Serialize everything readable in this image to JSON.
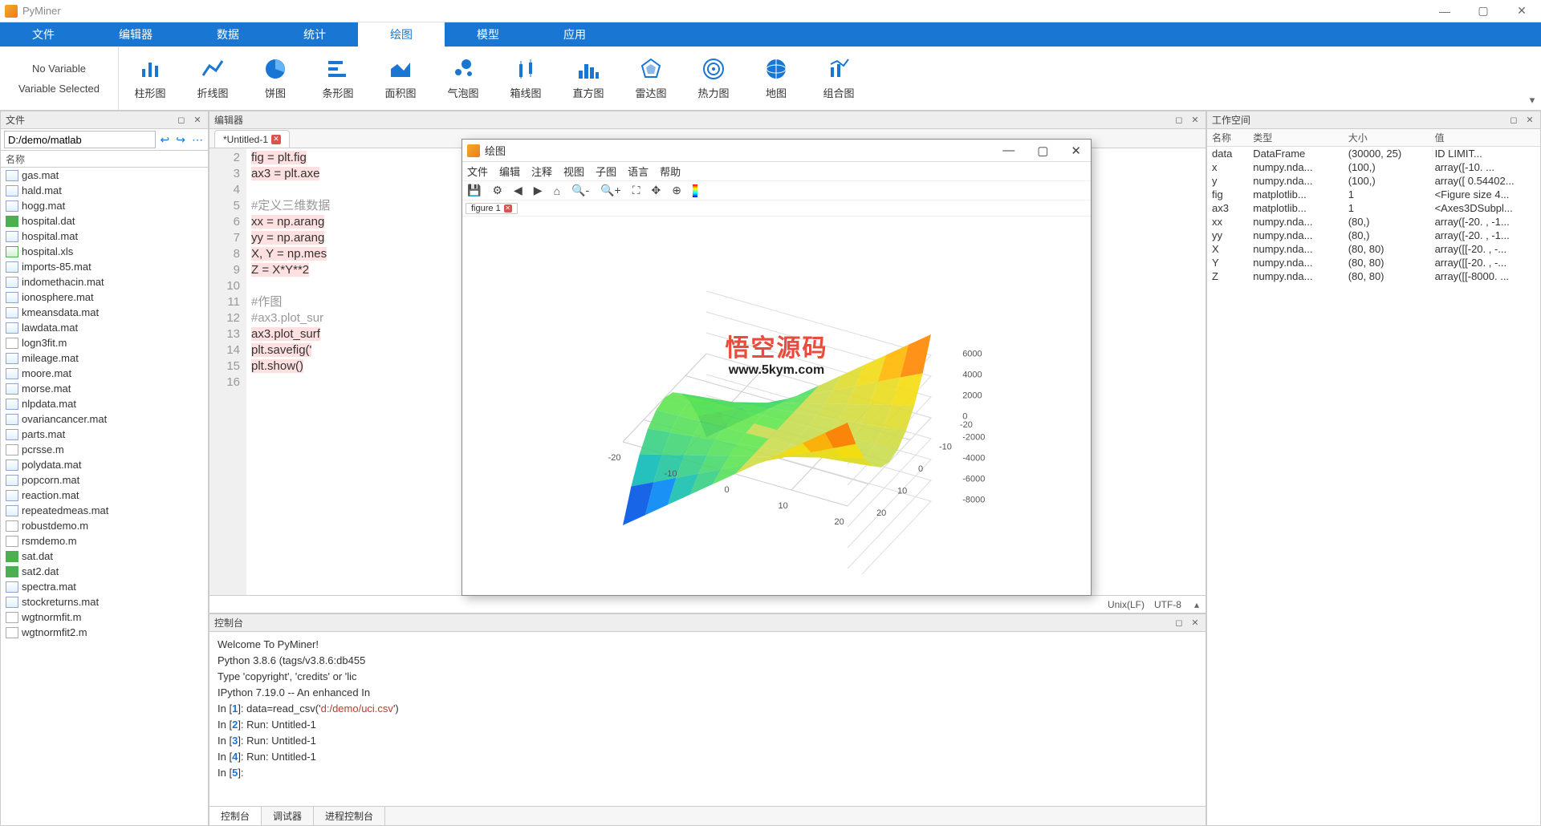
{
  "app": {
    "title": "PyMiner"
  },
  "mainmenu": [
    "文件",
    "编辑器",
    "数据",
    "统计",
    "绘图",
    "模型",
    "应用"
  ],
  "mainmenu_active": 4,
  "ribbon": {
    "var_top": "No Variable",
    "var_bottom": "Variable Selected",
    "tools": [
      "柱形图",
      "折线图",
      "饼图",
      "条形图",
      "面积图",
      "气泡图",
      "箱线图",
      "直方图",
      "雷达图",
      "热力图",
      "地图",
      "组合图"
    ]
  },
  "filePanel": {
    "title": "文件",
    "path": "D:/demo/matlab",
    "colHeader": "名称",
    "files": [
      {
        "name": "gas.mat",
        "type": "mat"
      },
      {
        "name": "hald.mat",
        "type": "mat"
      },
      {
        "name": "hogg.mat",
        "type": "mat"
      },
      {
        "name": "hospital.dat",
        "type": "dat"
      },
      {
        "name": "hospital.mat",
        "type": "mat"
      },
      {
        "name": "hospital.xls",
        "type": "xls"
      },
      {
        "name": "imports-85.mat",
        "type": "mat"
      },
      {
        "name": "indomethacin.mat",
        "type": "mat"
      },
      {
        "name": "ionosphere.mat",
        "type": "mat"
      },
      {
        "name": "kmeansdata.mat",
        "type": "mat"
      },
      {
        "name": "lawdata.mat",
        "type": "mat"
      },
      {
        "name": "logn3fit.m",
        "type": "mfile"
      },
      {
        "name": "mileage.mat",
        "type": "mat"
      },
      {
        "name": "moore.mat",
        "type": "mat"
      },
      {
        "name": "morse.mat",
        "type": "mat"
      },
      {
        "name": "nlpdata.mat",
        "type": "mat"
      },
      {
        "name": "ovariancancer.mat",
        "type": "mat"
      },
      {
        "name": "parts.mat",
        "type": "mat"
      },
      {
        "name": "pcrsse.m",
        "type": "mfile"
      },
      {
        "name": "polydata.mat",
        "type": "mat"
      },
      {
        "name": "popcorn.mat",
        "type": "mat"
      },
      {
        "name": "reaction.mat",
        "type": "mat"
      },
      {
        "name": "repeatedmeas.mat",
        "type": "mat"
      },
      {
        "name": "robustdemo.m",
        "type": "mfile"
      },
      {
        "name": "rsmdemo.m",
        "type": "mfile"
      },
      {
        "name": "sat.dat",
        "type": "dat"
      },
      {
        "name": "sat2.dat",
        "type": "dat"
      },
      {
        "name": "spectra.mat",
        "type": "mat"
      },
      {
        "name": "stockreturns.mat",
        "type": "mat"
      },
      {
        "name": "wgtnormfit.m",
        "type": "mfile"
      },
      {
        "name": "wgtnormfit2.m",
        "type": "mfile"
      }
    ]
  },
  "editor": {
    "panelTitle": "编辑器",
    "tab": "*Untitled-1",
    "lineStart": 2,
    "lines": [
      {
        "t": "fig = plt.fig",
        "cls": "kw"
      },
      {
        "t": "ax3 = plt.axe",
        "cls": "kw"
      },
      {
        "t": "",
        "cls": ""
      },
      {
        "t": "#定义三维数据",
        "cls": "cmt"
      },
      {
        "t": "xx = np.arang",
        "cls": "kw"
      },
      {
        "t": "yy = np.arang",
        "cls": "kw"
      },
      {
        "t": "X, Y = np.mes",
        "cls": "kw"
      },
      {
        "t": "Z = X*Y**2",
        "cls": "kw"
      },
      {
        "t": "",
        "cls": ""
      },
      {
        "t": "#作图",
        "cls": "cmt"
      },
      {
        "t": "#ax3.plot_sur",
        "cls": "cmt"
      },
      {
        "t": "ax3.plot_surf",
        "cls": "kw"
      },
      {
        "t": "plt.savefig('",
        "cls": "kw"
      },
      {
        "t": "plt.show()",
        "cls": "kw"
      },
      {
        "t": "",
        "cls": ""
      }
    ],
    "status": {
      "eol": "Unix(LF)",
      "enc": "UTF-8"
    }
  },
  "console": {
    "panelTitle": "控制台",
    "welcome": [
      "Welcome To PyMiner!",
      "Python 3.8.6 (tags/v3.8.6:db455",
      "Type 'copyright', 'credits' or 'lic",
      "IPython 7.19.0 -- An enhanced In"
    ],
    "entries": [
      {
        "n": "1",
        "t": "data=read_csv('",
        "path": "d:/demo/uci.csv",
        "tail": "')"
      },
      {
        "n": "2",
        "t": "Run: Untitled-1"
      },
      {
        "n": "3",
        "t": "Run: Untitled-1"
      },
      {
        "n": "4",
        "t": "Run: Untitled-1"
      },
      {
        "n": "5",
        "t": ""
      }
    ],
    "tabs": [
      "控制台",
      "调试器",
      "进程控制台"
    ],
    "activeTab": 0
  },
  "workspace": {
    "panelTitle": "工作空间",
    "cols": [
      "名称",
      "类型",
      "大小",
      "值"
    ],
    "rows": [
      [
        "data",
        "DataFrame",
        "(30000, 25)",
        "      ID   LIMIT..."
      ],
      [
        "x",
        "numpy.nda...",
        "(100,)",
        "array([-10.         ..."
      ],
      [
        "y",
        "numpy.nda...",
        "(100,)",
        "array([ 0.54402..."
      ],
      [
        "fig",
        "matplotlib...",
        "1",
        "<Figure size 4..."
      ],
      [
        "ax3",
        "matplotlib...",
        "1",
        "<Axes3DSubpl..."
      ],
      [
        "xx",
        "numpy.nda...",
        "(80,)",
        "array([-20. , -1..."
      ],
      [
        "yy",
        "numpy.nda...",
        "(80,)",
        "array([-20. , -1..."
      ],
      [
        "X",
        "numpy.nda...",
        "(80, 80)",
        "array([[-20. , -..."
      ],
      [
        "Y",
        "numpy.nda...",
        "(80, 80)",
        "array([[-20. , -..."
      ],
      [
        "Z",
        "numpy.nda...",
        "(80, 80)",
        "array([[-8000. ..."
      ]
    ]
  },
  "plotwin": {
    "title": "绘图",
    "menu": [
      "文件",
      "编辑",
      "注释",
      "视图",
      "子图",
      "语言",
      "帮助"
    ],
    "figtab": "figure 1",
    "watermark": {
      "main": "悟空源码",
      "url": "www.5kym.com"
    }
  },
  "chart_data": {
    "type": "surface3d",
    "xlabel": "",
    "ylabel": "",
    "zlabel": "",
    "x_ticks": [
      -20,
      -10,
      0,
      10,
      20
    ],
    "y_ticks": [
      -20,
      -10,
      0,
      10,
      20
    ],
    "z_ticks": [
      -8000,
      -6000,
      -4000,
      -2000,
      0,
      2000,
      4000,
      6000
    ],
    "x_range": [
      -20,
      20
    ],
    "y_range": [
      -20,
      20
    ],
    "z_range": [
      -8000,
      8000
    ],
    "formula": "Z = X * Y**2",
    "colormap": "jet",
    "grid": true
  }
}
